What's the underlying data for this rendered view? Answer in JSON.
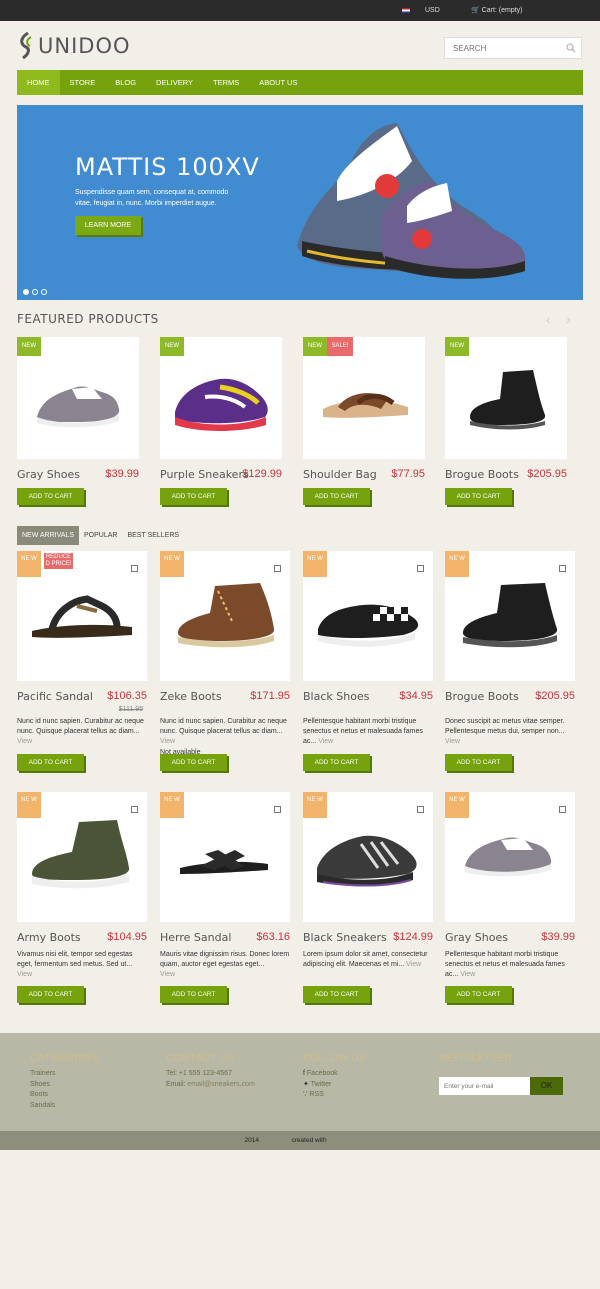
{
  "topbar": {
    "currency": "USD",
    "cart": "Cart: (empty)"
  },
  "logo": {
    "name": "UNIDOO"
  },
  "search": {
    "placeholder": "SEARCH"
  },
  "nav": [
    "HOME",
    "STORE",
    "BLOG",
    "DELIVERY",
    "TERMS",
    "ABOUT US"
  ],
  "hero": {
    "title": "MATTIS 100XV",
    "text": "Suspendisse quam sem, consequat at, commodo vitae, feugiat in, nunc. Morbi imperdiet augue.",
    "button": "LEARN MORE"
  },
  "featured": {
    "title": "FEATURED PRODUCTS",
    "items": [
      {
        "name": "Gray Shoes",
        "price": "$39.99",
        "badge": "NEW",
        "button": "ADD TO CART"
      },
      {
        "name": "Purple Sneakers",
        "price": "$129.99",
        "badge": "NEW",
        "button": "ADD TO CART"
      },
      {
        "name": "Shoulder Bag",
        "price": "$77.95",
        "badge": "NEW",
        "badge2": "SALE!",
        "button": "ADD TO CART"
      },
      {
        "name": "Brogue Boots",
        "price": "$205.95",
        "badge": "NEW",
        "button": "ADD TO CART"
      }
    ]
  },
  "tabs": [
    "NEW ARRIVALS",
    "POPULAR",
    "BEST SELLERS"
  ],
  "arrivals": [
    {
      "name": "Pacific Sandal",
      "price": "$106.35",
      "old": "$111.95",
      "badge": "NE W",
      "badge2": "REDUCE D PRICE!",
      "desc": "Nunc id nunc sapien. Curabitur ac neque nunc. Quisque placerat tellus ac diam...",
      "view": "View",
      "button": "ADD TO CART"
    },
    {
      "name": "Zeke Boots",
      "price": "$171.95",
      "badge": "NE W",
      "desc": "Nunc id nunc sapien. Curabitur ac neque nunc. Quisque placerat tellus ac diam...",
      "view": "View",
      "avail": "Not available",
      "button": "ADD TO CART"
    },
    {
      "name": "Black Shoes",
      "price": "$34.95",
      "badge": "NE W",
      "desc": "Pellentesque habitant morbi tristique senectus et netus et malesuada fames ac...",
      "view": "View",
      "button": "ADD TO CART"
    },
    {
      "name": "Brogue Boots",
      "price": "$205.95",
      "badge": "NE W",
      "desc": "Donec suscipit ac metus vitae semper. Pellentesque metus dui, semper non...",
      "view": "View",
      "button": "ADD TO CART"
    },
    {
      "name": "Army Boots",
      "price": "$104.95",
      "badge": "NE W",
      "desc": "Vivamus nisi elit, tempor sed egestas eget, fermentum sed metus. Sed ut...",
      "view": "View",
      "button": "ADD TO CART"
    },
    {
      "name": "Herre Sandal",
      "price": "$63.16",
      "badge": "NE W",
      "desc": "Mauris vitae dignissim risus. Donec lorem quam, auctor eget egestas eget...",
      "view": "View",
      "button": "ADD TO CART"
    },
    {
      "name": "Black Sneakers",
      "price": "$124.99",
      "badge": "NE W",
      "desc": "Lorem ipsum dolor sit amet, consectetur adipiscing elit. Maecenas et mi...",
      "view": "View",
      "button": "ADD TO CART"
    },
    {
      "name": "Gray Shoes",
      "price": "$39.99",
      "badge": "NE W",
      "desc": "Pellentesque habitant morbi tristique senectus et netus et malesuada fames ac...",
      "view": "View",
      "button": "ADD TO CART"
    }
  ],
  "footer": {
    "categories": {
      "title": "CATEGORIES",
      "items": [
        "Trainers",
        "Shoes",
        "Boots",
        "Sandals"
      ]
    },
    "contact": {
      "title": "CONTACT US",
      "tel": "Tel: +1 555 123-4567",
      "email_label": "Email:",
      "email": "email@sneakers.com"
    },
    "follow": {
      "title": "FOLLOW US",
      "items": [
        "Facebook",
        "Twitter",
        "RSS"
      ]
    },
    "newsletter": {
      "title": "NEWSLETTER",
      "placeholder": "Enter your e-mail",
      "button": "OK"
    }
  },
  "copyright": {
    "year": "2014",
    "created": "created with"
  },
  "colors": {
    "accent": "#76a30d",
    "price": "#c8353e",
    "new_badge": "#8eba2a",
    "new_badge2": "#f2b36a",
    "sale": "#e86a6a",
    "hero": "#418bd0"
  }
}
